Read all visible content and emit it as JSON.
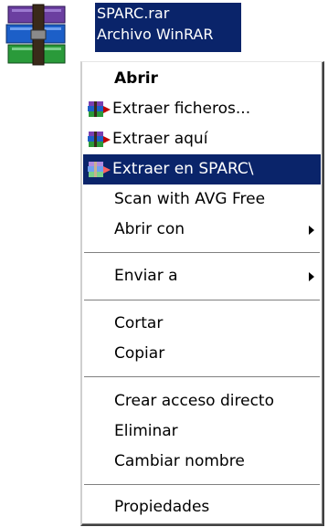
{
  "desktop_file": {
    "name": "SPARC.rar",
    "type": "Archivo WinRAR",
    "icon": "winrar-archive-icon"
  },
  "context_menu": {
    "items": [
      {
        "label": "Abrir"
      },
      {
        "label": "Extraer ficheros...",
        "icon": "winrar-extract-icon"
      },
      {
        "label": "Extraer aquí",
        "icon": "winrar-extract-icon"
      },
      {
        "label": "Extraer en SPARC\\",
        "icon": "winrar-extract-icon"
      },
      {
        "label": "Scan with AVG Free"
      },
      {
        "label": "Abrir con"
      },
      {
        "label": "Enviar a"
      },
      {
        "label": "Cortar"
      },
      {
        "label": "Copiar"
      },
      {
        "label": "Crear acceso directo"
      },
      {
        "label": "Eliminar"
      },
      {
        "label": "Cambiar nombre"
      },
      {
        "label": "Propiedades"
      }
    ]
  },
  "colors": {
    "selection": "#0a246a",
    "menu_background": "#ffffff",
    "separator": "#808080"
  }
}
